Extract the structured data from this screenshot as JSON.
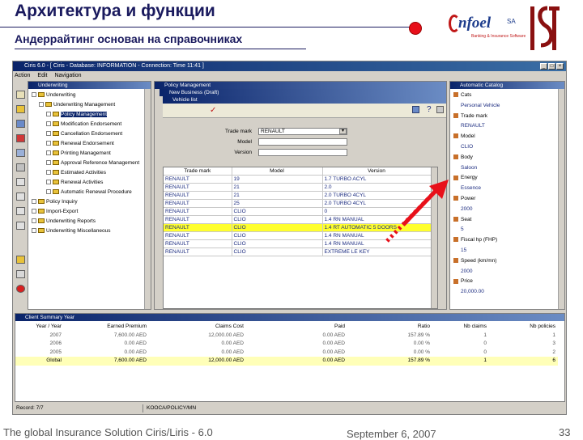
{
  "slide": {
    "title": "Архитектура и функции",
    "subtitle": "Андеррайтинг основан на справочниках",
    "logo_brand": "nfoel",
    "logo_sa": "SA",
    "logo_tag": "Banking & Insurance Software",
    "footer_left": "The global Insurance Solution  Ciris/Liris - 6.0",
    "footer_date": "September 6, 2007",
    "page_number": "33"
  },
  "app": {
    "window_title": "Ciris 6.0 - [ Ciris - Database: INFORMATION - Connection: Time 11:41 ]",
    "menu": [
      "Action",
      "Edit",
      "Navigation"
    ]
  },
  "tree": {
    "title": "Underwriting",
    "items": [
      {
        "label": "Underwriting",
        "level": 0,
        "selected": false
      },
      {
        "label": "Underwriting Management",
        "level": 1,
        "selected": false
      },
      {
        "label": "Policy Management",
        "level": 2,
        "selected": true
      },
      {
        "label": "Modification Endorsement",
        "level": 2,
        "selected": false
      },
      {
        "label": "Cancellation Endorsement",
        "level": 2,
        "selected": false
      },
      {
        "label": "Renewal Endorsement",
        "level": 2,
        "selected": false
      },
      {
        "label": "Printing Management",
        "level": 2,
        "selected": false
      },
      {
        "label": "Approval Reference Management",
        "level": 2,
        "selected": false
      },
      {
        "label": "Estimated Activities",
        "level": 2,
        "selected": false
      },
      {
        "label": "Renewal Activities",
        "level": 2,
        "selected": false
      },
      {
        "label": "Automatic Renewal Procedure",
        "level": 2,
        "selected": false
      },
      {
        "label": "Policy Inquiry",
        "level": 0,
        "selected": false
      },
      {
        "label": "Import-Export",
        "level": 0,
        "selected": false
      },
      {
        "label": "Underwriting Reports",
        "level": 0,
        "selected": false
      },
      {
        "label": "Underwriting Miscellaneous",
        "level": 0,
        "selected": false
      }
    ]
  },
  "policy_window": {
    "title": "Policy Management",
    "subtitle": "New Business (Draft)",
    "vehicle_title": "Vehicle list"
  },
  "vehicle_form": {
    "trade_mark_label": "Trade mark",
    "trade_mark_value": "RENAULT",
    "model_label": "Model",
    "version_label": "Version"
  },
  "vehicle_grid": {
    "columns": [
      "Trade mark",
      "Model",
      "Version"
    ],
    "rows": [
      {
        "trade": "RENAULT",
        "model": "19",
        "version": "1.7 TURBO ACYL",
        "highlight": false
      },
      {
        "trade": "RENAULT",
        "model": "21",
        "version": "2.0",
        "highlight": false
      },
      {
        "trade": "RENAULT",
        "model": "21",
        "version": "2.0 TURBO 4CYL",
        "highlight": false
      },
      {
        "trade": "RENAULT",
        "model": "25",
        "version": "2.0 TURBO 4CYL",
        "highlight": false
      },
      {
        "trade": "RENAULT",
        "model": "CLIO",
        "version": "0",
        "highlight": false
      },
      {
        "trade": "RENAULT",
        "model": "CLIO",
        "version": "1.4 RN MANUAL",
        "highlight": false
      },
      {
        "trade": "RENAULT",
        "model": "CLIO",
        "version": "1.4 RT AUTOMATIC 5 DOORS",
        "highlight": true
      },
      {
        "trade": "RENAULT",
        "model": "CLIO",
        "version": "1.4 RN MANUAL",
        "highlight": false
      },
      {
        "trade": "RENAULT",
        "model": "CLIO",
        "version": "1.4 RN MANUAL",
        "highlight": false
      },
      {
        "trade": "RENAULT",
        "model": "CLIO",
        "version": "EXTREME LE KEY",
        "highlight": false
      }
    ]
  },
  "catalog": {
    "title": "Automatic Catalog",
    "items": [
      {
        "label": "Cats",
        "kind": "key"
      },
      {
        "label": "Personal Vehicle",
        "kind": "val"
      },
      {
        "label": "Trade mark",
        "kind": "key"
      },
      {
        "label": "RENAULT",
        "kind": "val"
      },
      {
        "label": "Model",
        "kind": "key"
      },
      {
        "label": "CLIO",
        "kind": "val"
      },
      {
        "label": "Body",
        "kind": "key"
      },
      {
        "label": "Saloon",
        "kind": "val"
      },
      {
        "label": "Energy",
        "kind": "key"
      },
      {
        "label": "Essence",
        "kind": "val"
      },
      {
        "label": "Power",
        "kind": "key"
      },
      {
        "label": "2000",
        "kind": "val"
      },
      {
        "label": "Seat",
        "kind": "key"
      },
      {
        "label": "5",
        "kind": "val"
      },
      {
        "label": "Fiscal hp (FHP)",
        "kind": "key"
      },
      {
        "label": "15",
        "kind": "val"
      },
      {
        "label": "Speed (km/mn)",
        "kind": "key"
      },
      {
        "label": "2000",
        "kind": "val"
      },
      {
        "label": "Price",
        "kind": "key"
      },
      {
        "label": "20,000.00",
        "kind": "val"
      }
    ]
  },
  "summary": {
    "title": "Client Summary Year",
    "columns": [
      "Year / Year",
      "Earned Premium",
      "Claims Cost",
      "Paid",
      "Ratio",
      "Nb claims",
      "Nb policies"
    ],
    "rows": [
      {
        "year": "2007",
        "earned": "7,600.00 AED",
        "claims": "12,000.00 AED",
        "paid": "0.00 AED",
        "ratio": "157.89 %",
        "nbc": "1",
        "nbp": "1"
      },
      {
        "year": "2006",
        "earned": "0.00 AED",
        "claims": "0.00 AED",
        "paid": "0.00 AED",
        "ratio": "0.00 %",
        "nbc": "0",
        "nbp": "3"
      },
      {
        "year": "2005",
        "earned": "0.00 AED",
        "claims": "0.00 AED",
        "paid": "0.00 AED",
        "ratio": "0.00 %",
        "nbc": "0",
        "nbp": "2"
      }
    ],
    "total": {
      "year": "Global",
      "earned": "7,600.00 AED",
      "claims": "12,000.00 AED",
      "paid": "0.00 AED",
      "ratio": "157.89 %",
      "nbc": "1",
      "nbp": "6"
    }
  },
  "statusbar": {
    "record": "Record: 7/7",
    "code": "KOOCA/POLICY/MN"
  },
  "colors": {
    "title_navy": "#1a1a5e",
    "accent_red": "#e8101a",
    "highlight_yellow": "#ffff2e"
  }
}
